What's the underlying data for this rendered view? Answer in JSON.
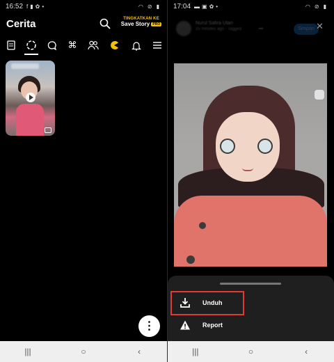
{
  "left": {
    "status": {
      "time": "16:52"
    },
    "header": {
      "title": "Cerita",
      "promo_top": "TINGKATKAN KE",
      "promo_main": "Save Story",
      "promo_badge": "PRO"
    },
    "tabs": [
      "stories",
      "status",
      "chat",
      "shortcuts",
      "people",
      "pacman",
      "notifications",
      "menu"
    ],
    "fab_icon": "more-vertical-icon"
  },
  "right": {
    "status": {
      "time": "17:04"
    },
    "header": {
      "name": "Nurul Safira Utari",
      "subtitle": "25 minutes ago · Tagged",
      "save_label": "Simpan"
    },
    "sheet": {
      "items": [
        {
          "label": "Unduh",
          "icon": "download-icon"
        },
        {
          "label": "Report",
          "icon": "warning-icon"
        }
      ]
    }
  },
  "colors": {
    "accent_pro": "#f4c20d",
    "highlight": "#e53935",
    "save_button": "#1e88e5"
  }
}
